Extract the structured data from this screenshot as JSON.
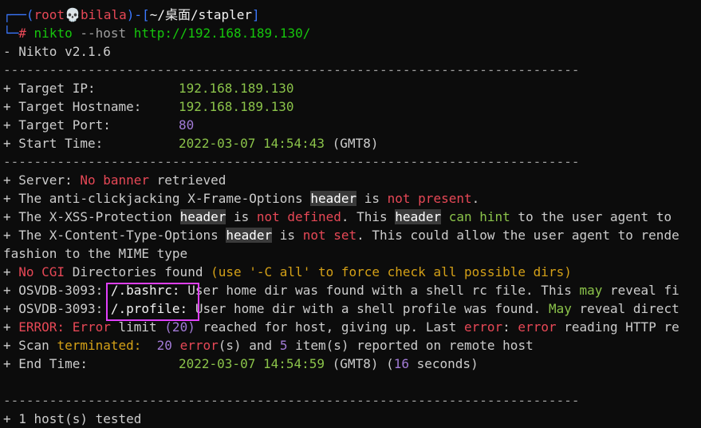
{
  "prompt": {
    "corner1": "┌──(",
    "user": "root",
    "skull": "💀",
    "host": "bilala",
    "sep": ")-[",
    "path": "~/桌面/stapler",
    "close": "]",
    "corner2": "└─",
    "hash": "#",
    "cmd": "nikto",
    "flag": "--host",
    "url": "http://192.168.189.130/"
  },
  "version": "- Nikto v2.1.6",
  "divider": "---------------------------------------------------------------------------",
  "target": {
    "ip_label": "+ Target IP:",
    "ip": "192.168.189.130",
    "hostname_label": "+ Target Hostname:",
    "hostname": "192.168.189.130",
    "port_label": "+ Target Port:",
    "port": "80",
    "start_label": "+ Start Time:",
    "start": "2022-03-07 14:54:43",
    "start_tz": "(GMT8)"
  },
  "findings": {
    "server_a": "+ Server: ",
    "server_b": "No banner",
    "server_c": " retrieved",
    "clickjack_a": "+ The anti-clickjacking X-Frame-Options ",
    "clickjack_b": "header",
    "clickjack_c": " is ",
    "clickjack_d": "not present",
    "clickjack_e": ".",
    "xss_a": "+ The X-XSS-Protection ",
    "xss_b": "header",
    "xss_c": " is ",
    "xss_d": "not defined",
    "xss_e": ". This ",
    "xss_f": "header",
    "xss_g": " can hint",
    "xss_h": " to the user agent to",
    "ct_a": "+ The X-Content-Type-Options ",
    "ct_b": "header",
    "ct_c": " is ",
    "ct_d": "not set",
    "ct_e": ". This could allow the user agent to rende",
    "ct_wrap": "fashion to the MIME type",
    "cgi_a": "+ ",
    "cgi_b": "No CGI",
    "cgi_c": " Directories found ",
    "cgi_d": "(use '-C all' to force check all possible dirs)",
    "osvdb1_a": "+ OSVDB-3093: ",
    "osvdb1_b": "/.bashrc:",
    "osvdb1_c": " User home dir was found with a shell rc file. This ",
    "osvdb1_d": "may",
    "osvdb1_e": " reveal fi",
    "osvdb2_a": "+ OSVDB-3093: ",
    "osvdb2_b": "/.profile:",
    "osvdb2_c": " User home dir with a shell profile was found. ",
    "osvdb2_d": "May",
    "osvdb2_e": " reveal direct",
    "error_a": "+ ",
    "error_b": "ERROR:",
    "error_c": " Error",
    "error_d": " limit ",
    "error_e": "(20)",
    "error_f": " reached for host, giving up. Last ",
    "error_g": "error",
    "error_h": ": ",
    "error_i": "error",
    "error_j": " reading HTTP re",
    "scan_a": "+ Scan ",
    "scan_b": "terminated:",
    "scan_c": "  20 ",
    "scan_d": "error",
    "scan_e": "(s) and ",
    "scan_f": "5",
    "scan_g": " item(s) reported on remote host",
    "end_label": "+ End Time:",
    "end": "2022-03-07 14:54:59",
    "end_tz": "(GMT8)",
    "end_dur_a": " (",
    "end_dur_b": "16",
    "end_dur_c": " seconds)",
    "tested_a": "+ 1 host(s) tested"
  },
  "colors": {
    "background": "#0c0c0c",
    "highlight_box": "#e040fb"
  }
}
